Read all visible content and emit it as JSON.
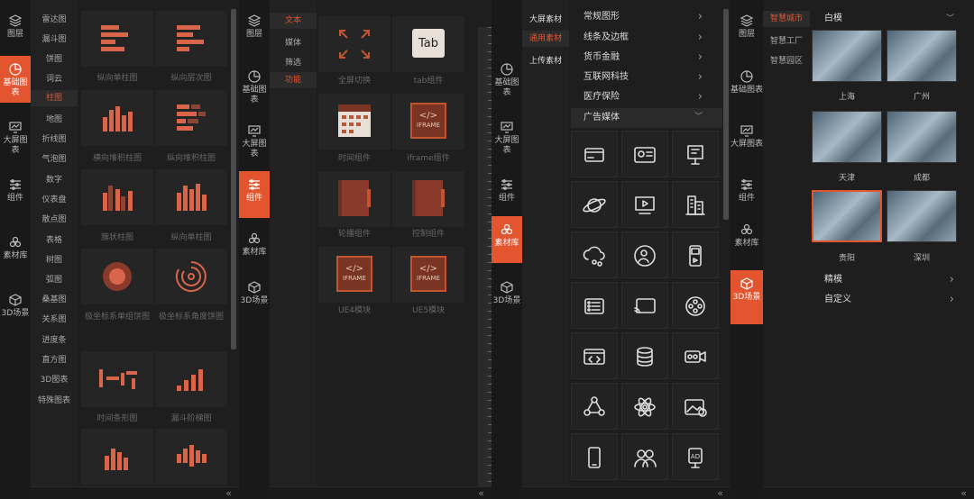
{
  "panel1": {
    "rail": [
      {
        "label": "图层",
        "icon": "layers-icon"
      },
      {
        "label": "基础图表",
        "icon": "pie-chart-icon",
        "active": true
      },
      {
        "label": "大屏图表",
        "icon": "monitor-chart-icon"
      },
      {
        "label": "组件",
        "icon": "sliders-icon"
      },
      {
        "label": "素材库",
        "icon": "material-icon"
      },
      {
        "label": "3D场景",
        "icon": "cube-icon"
      }
    ],
    "categories": [
      "雷达图",
      "漏斗图",
      "饼图",
      "词云",
      "柱图",
      "地图",
      "折线图",
      "气泡图",
      "数字",
      "仪表盘",
      "散点图",
      "表格",
      "树图",
      "弧图",
      "桑基图",
      "关系图",
      "进度条",
      "直方图",
      "3D图表",
      "特殊图表"
    ],
    "active_category": "柱图",
    "items": [
      "纵向单柱图",
      "纵向层次图",
      "横向堆积柱图",
      "纵向堆积柱图",
      "簇状柱图",
      "纵向单柱图",
      "极坐标系单组饼图",
      "极坐标系角度饼图",
      "时间条形图",
      "漏斗阶梯图",
      "",
      ""
    ]
  },
  "panel2": {
    "rail": [
      {
        "label": "图层"
      },
      {
        "label": "基础图表"
      },
      {
        "label": "大屏图表"
      },
      {
        "label": "组件",
        "active": true
      },
      {
        "label": "素材库"
      },
      {
        "label": "3D场景"
      }
    ],
    "categories": [
      "文本",
      "媒体",
      "筛选",
      "功能"
    ],
    "active_category": "功能",
    "items": [
      {
        "label": "全屏切换",
        "icon": "fullscreen-icon"
      },
      {
        "label": "tab组件",
        "icon": "tab-icon",
        "text": "Tab"
      },
      {
        "label": "时间组件",
        "icon": "calendar-icon"
      },
      {
        "label": "iframe组件",
        "icon": "iframe-icon",
        "text": "IFRAME"
      },
      {
        "label": "轮播组件",
        "icon": "book-icon"
      },
      {
        "label": "控制组件",
        "icon": "book-icon"
      },
      {
        "label": "UE4模块",
        "icon": "iframe-icon",
        "text": "IFRAME"
      },
      {
        "label": "UE5模块",
        "icon": "iframe-icon",
        "text": "IFRAME"
      }
    ]
  },
  "panel3": {
    "rail": [
      {
        "label": "基础图表"
      },
      {
        "label": "大屏图表"
      },
      {
        "label": "组件"
      },
      {
        "label": "素材库",
        "active": true
      },
      {
        "label": "3D场景"
      }
    ],
    "sources": [
      "大屏素材",
      "通用素材",
      "上传素材"
    ],
    "active_source": "通用素材",
    "groups": [
      "常规图形",
      "线条及边框",
      "货币金融",
      "互联网科技",
      "医疗保险",
      "广告媒体"
    ],
    "open_group": "广告媒体",
    "icons": [
      "card-icon",
      "id-card-icon",
      "billboard-icon",
      "planet-icon",
      "video-icon",
      "buildings-icon",
      "cloud-network-icon",
      "user-circle-icon",
      "mobile-player-icon",
      "form-icon",
      "cast-icon",
      "film-reel-icon",
      "code-window-icon",
      "database-icon",
      "camera-icon",
      "network-icon",
      "atom-icon",
      "image-copyright-icon",
      "phone-icon",
      "users-icon",
      "ad-stand-icon"
    ]
  },
  "panel4": {
    "rail": [
      {
        "label": "图层"
      },
      {
        "label": "基础图表"
      },
      {
        "label": "大屏图表"
      },
      {
        "label": "组件"
      },
      {
        "label": "素材库"
      },
      {
        "label": "3D场景",
        "active": true
      }
    ],
    "scenes": [
      "智慧城市",
      "智慧工厂",
      "智慧园区"
    ],
    "active_scene": "智慧城市",
    "dropdown_label": "白模",
    "cities": [
      "上海",
      "广州",
      "天津",
      "成都",
      "贵阳",
      "深圳"
    ],
    "selected_city": "贵阳",
    "sections": [
      "精模",
      "自定义"
    ]
  },
  "collapse_glyph": "«",
  "chevron_glyph": "›"
}
